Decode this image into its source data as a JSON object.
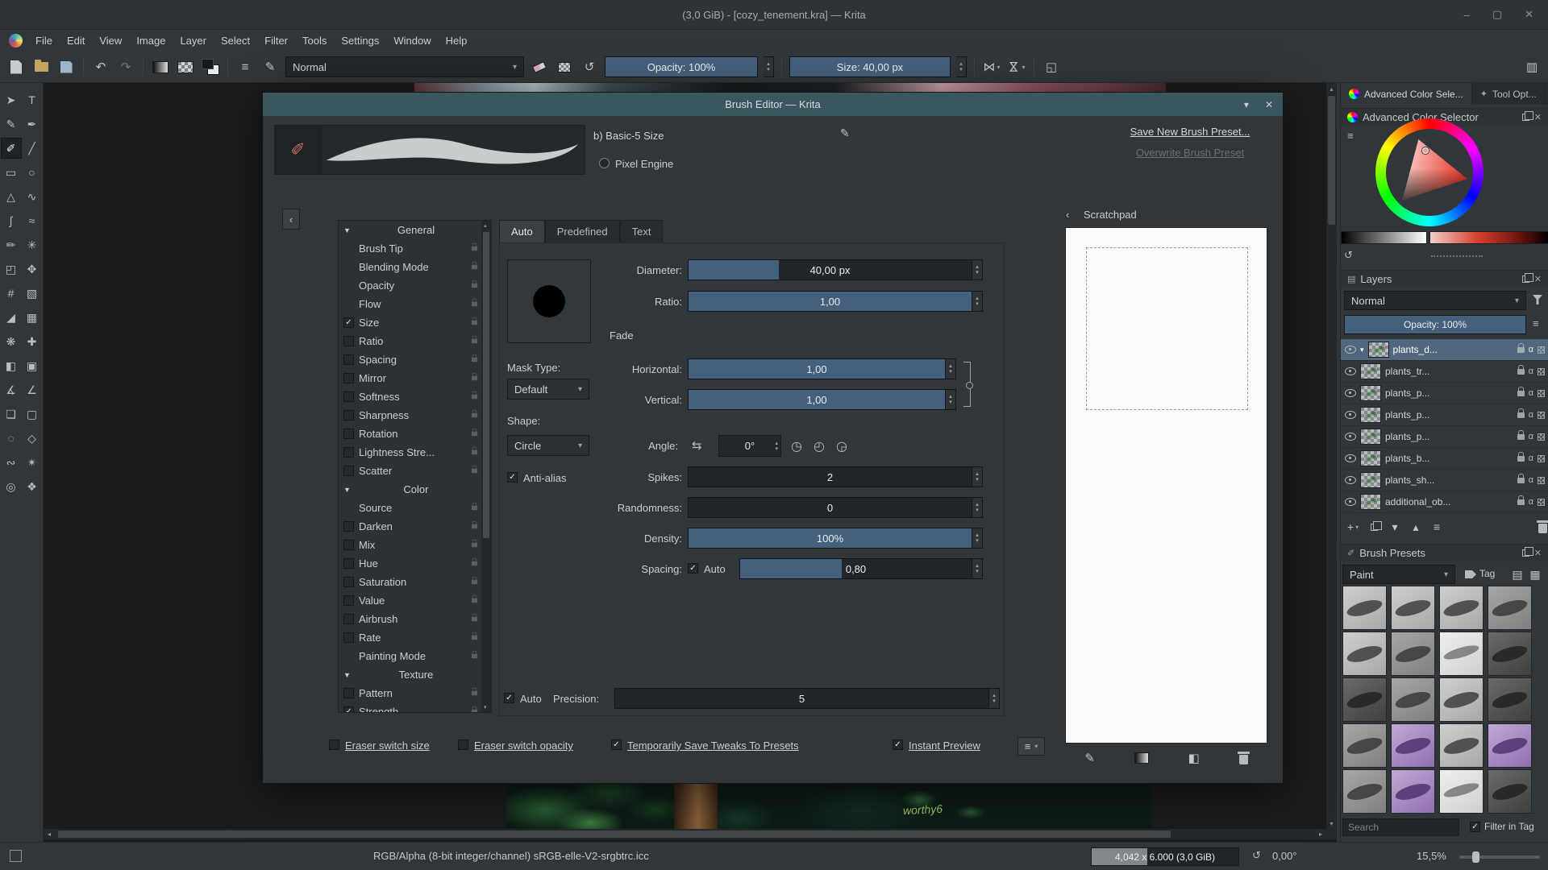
{
  "titlebar": {
    "title": "(3,0 GiB) - [cozy_tenement.kra] — Krita"
  },
  "menubar": {
    "items": [
      "File",
      "Edit",
      "View",
      "Image",
      "Layer",
      "Select",
      "Filter",
      "Tools",
      "Settings",
      "Window",
      "Help"
    ]
  },
  "toolbar": {
    "blending_mode": "Normal",
    "opacity": "Opacity: 100%",
    "size": "Size: 40,00 px"
  },
  "toolbox": {
    "selected": "freehand-brush",
    "tools": [
      {
        "name": "select-shapes",
        "glyph": "➤"
      },
      {
        "name": "text",
        "glyph": "T"
      },
      {
        "name": "edit-shapes",
        "glyph": "✎"
      },
      {
        "name": "calligraphy",
        "glyph": "✒"
      },
      {
        "name": "freehand-brush",
        "glyph": "✐"
      },
      {
        "name": "line",
        "glyph": "╱"
      },
      {
        "name": "rectangle",
        "glyph": "▭"
      },
      {
        "name": "ellipse",
        "glyph": "○"
      },
      {
        "name": "polygon",
        "glyph": "△"
      },
      {
        "name": "polyline",
        "glyph": "∿"
      },
      {
        "name": "bezier-curve",
        "glyph": "∫"
      },
      {
        "name": "freehand-path",
        "glyph": "≈"
      },
      {
        "name": "dynamic-brush",
        "glyph": "✏"
      },
      {
        "name": "multibrush",
        "glyph": "✳"
      },
      {
        "name": "transform",
        "glyph": "◰"
      },
      {
        "name": "move",
        "glyph": "✥"
      },
      {
        "name": "crop",
        "glyph": "#"
      },
      {
        "name": "gradient",
        "glyph": "▧"
      },
      {
        "name": "color-sampler",
        "glyph": "◢"
      },
      {
        "name": "pattern",
        "glyph": "▦"
      },
      {
        "name": "colorize-mask",
        "glyph": "❋"
      },
      {
        "name": "smart-patch",
        "glyph": "✚"
      },
      {
        "name": "fill",
        "glyph": "◧"
      },
      {
        "name": "enclose-fill",
        "glyph": "▣"
      },
      {
        "name": "assistants",
        "glyph": "∡"
      },
      {
        "name": "measure",
        "glyph": "∠"
      },
      {
        "name": "reference-images",
        "glyph": "❏"
      },
      {
        "name": "rect-select",
        "glyph": "▢"
      },
      {
        "name": "ellipse-select",
        "glyph": "◌"
      },
      {
        "name": "polygon-select",
        "glyph": "◇"
      },
      {
        "name": "freehand-select",
        "glyph": "∾"
      },
      {
        "name": "similar-select",
        "glyph": "✴"
      },
      {
        "name": "zoom",
        "glyph": "◎"
      },
      {
        "name": "pan",
        "glyph": "❖"
      }
    ]
  },
  "canvas": {
    "signature": "worthy6"
  },
  "dialog": {
    "title": "Brush Editor — Krita",
    "preset_name": "b) Basic-5 Size",
    "engine_label": "Pixel Engine",
    "save_new_label": "Save New Brush Preset...",
    "overwrite_label": "Overwrite Brush Preset",
    "tabs": [
      "Auto",
      "Predefined",
      "Text"
    ],
    "active_tab": "Auto",
    "sections": [
      {
        "title": "General",
        "items": [
          {
            "label": "Brush Tip"
          },
          {
            "label": "Blending Mode"
          },
          {
            "label": "Opacity"
          },
          {
            "label": "Flow"
          },
          {
            "label": "Size",
            "checked": true
          },
          {
            "label": "Ratio",
            "checked": false
          },
          {
            "label": "Spacing",
            "checked": false
          },
          {
            "label": "Mirror",
            "checked": false
          },
          {
            "label": "Softness",
            "checked": false
          },
          {
            "label": "Sharpness",
            "checked": false
          },
          {
            "label": "Rotation",
            "checked": false
          },
          {
            "label": "Lightness Stre...",
            "checked": false
          },
          {
            "label": "Scatter",
            "checked": false
          }
        ]
      },
      {
        "title": "Color",
        "items": [
          {
            "label": "Source"
          },
          {
            "label": "Darken",
            "checked": false
          },
          {
            "label": "Mix",
            "checked": false
          },
          {
            "label": "Hue",
            "checked": false
          },
          {
            "label": "Saturation",
            "checked": false
          },
          {
            "label": "Value",
            "checked": false
          },
          {
            "label": "Airbrush",
            "checked": false
          },
          {
            "label": "Rate",
            "checked": false
          },
          {
            "label": "Painting Mode"
          }
        ]
      },
      {
        "title": "Texture",
        "items": [
          {
            "label": "Pattern",
            "checked": false
          },
          {
            "label": "Strength",
            "checked": true
          }
        ]
      }
    ],
    "fields": {
      "diameter_label": "Diameter:",
      "diameter_value": "40,00 px",
      "ratio_label": "Ratio:",
      "ratio_value": "1,00",
      "fade_label": "Fade",
      "mask_type_label": "Mask Type:",
      "mask_type_value": "Default",
      "horizontal_label": "Horizontal:",
      "horizontal_value": "1,00",
      "vertical_label": "Vertical:",
      "vertical_value": "1,00",
      "shape_label": "Shape:",
      "shape_value": "Circle",
      "angle_label": "Angle:",
      "angle_value": "0°",
      "antialias_label": "Anti-alias",
      "spikes_label": "Spikes:",
      "spikes_value": "2",
      "randomness_label": "Randomness:",
      "randomness_value": "0",
      "density_label": "Density:",
      "density_value": "100%",
      "spacing_label": "Spacing:",
      "spacing_auto_label": "Auto",
      "spacing_value": "0,80",
      "auto_label": "Auto",
      "precision_label": "Precision:",
      "precision_value": "5"
    },
    "footer": {
      "eraser_switch_size": "Eraser switch size",
      "eraser_switch_opacity": "Eraser switch opacity",
      "save_tweaks": "Temporarily Save Tweaks To Presets",
      "instant_preview": "Instant Preview"
    },
    "scratchpad_title": "Scratchpad"
  },
  "docks": {
    "tabs": [
      "Advanced Color Sele...",
      "Tool Opt..."
    ],
    "color_selector": {
      "title": "Advanced Color Selector"
    },
    "layers": {
      "title": "Layers",
      "blend_mode": "Normal",
      "opacity": "Opacity: 100%",
      "rows": [
        {
          "name": "plants_d...",
          "selected": true,
          "group": true
        },
        {
          "name": "plants_tr..."
        },
        {
          "name": "plants_p..."
        },
        {
          "name": "plants_p..."
        },
        {
          "name": "plants_p..."
        },
        {
          "name": "plants_b..."
        },
        {
          "name": "plants_sh..."
        },
        {
          "name": "additional_ob..."
        }
      ]
    },
    "brush_presets": {
      "title": "Brush Presets",
      "tag_filter": "Paint",
      "tag_label": "Tag",
      "search_placeholder": "Search",
      "filter_label": "Filter in Tag",
      "thumbs": [
        "light",
        "light",
        "light",
        "gray",
        "light",
        "gray",
        "white",
        "dark",
        "dark",
        "gray",
        "light",
        "dark",
        "gray",
        "purple",
        "light",
        "purple",
        "gray",
        "purple",
        "white",
        "dark"
      ]
    }
  },
  "statusbar": {
    "colorspace": "RGB/Alpha (8-bit integer/channel)  sRGB-elle-V2-srgbtrc.icc",
    "memory": "4,042 x 6.000 (3,0 GiB)",
    "rotation": "0,00°",
    "zoom": "15,5%"
  }
}
